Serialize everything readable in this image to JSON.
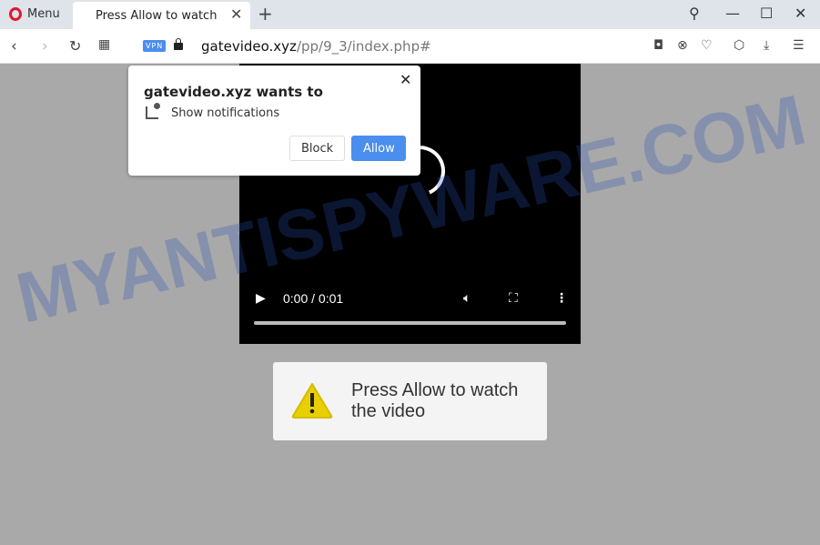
{
  "browser": {
    "menu_label": "Menu",
    "tab_title": "Press Allow to watch",
    "url_host": "gatevideo.xyz",
    "url_path": "/pp/9_3/index.php#",
    "vpn_badge": "VPN"
  },
  "permission_popup": {
    "title": "gatevideo.xyz wants to",
    "permission": "Show notifications",
    "block_label": "Block",
    "allow_label": "Allow"
  },
  "video": {
    "time": "0:00 / 0:01",
    "progress": 0
  },
  "notice": {
    "message": "Press Allow to watch the video",
    "icon": "warning-icon"
  },
  "watermark": "MYANTISPYWARE.COM",
  "colors": {
    "accent": "#4a8eee",
    "opera": "#e0182d",
    "warning": "#e8d000"
  }
}
